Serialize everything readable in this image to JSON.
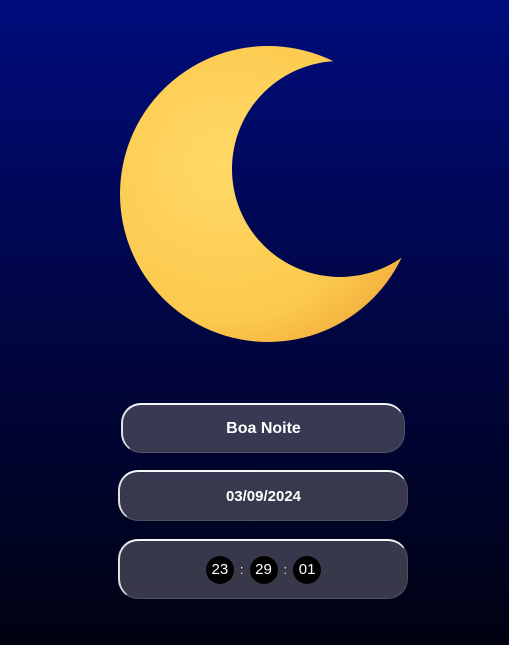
{
  "greeting": {
    "text": "Boa Noite"
  },
  "date": {
    "text": "03/09/2024"
  },
  "clock": {
    "hours": "23",
    "minutes": "29",
    "seconds": "01",
    "separator": ":"
  },
  "icons": {
    "moon": "crescent-moon-icon"
  },
  "colors": {
    "background_top": "#000c7d",
    "background_bottom": "#000211",
    "moon": "#fcc94e",
    "pill": "#505060"
  }
}
